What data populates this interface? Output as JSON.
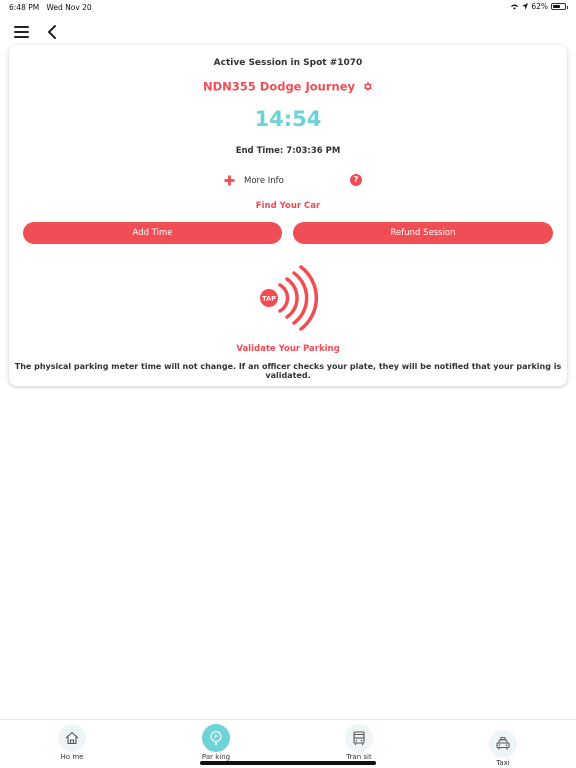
{
  "status_bar": {
    "time": "6:48 PM",
    "date": "Wed Nov 20",
    "battery": "62%",
    "battery_level": 0.62
  },
  "nav": {
    "menu_icon": "hamburger-menu-icon",
    "back_icon": "chevron-left-icon"
  },
  "session": {
    "title": "Active Session in Spot  #1070",
    "vehicle": "NDN355 Dodge Journey",
    "timer": "14:54",
    "end_time_label": "End Time: ",
    "end_time_value": "7:03:36 PM",
    "more_info": "More Info",
    "help_symbol": "?",
    "find_car": "Find Your Car",
    "add_time": "Add Time",
    "refund": "Refund Session",
    "tap_label": "TAP",
    "validate": "Validate Your Parking",
    "validate_note": "The physical parking meter time will not change. If an officer checks your plate, they will be notified that your parking is validated."
  },
  "tabs": [
    {
      "label": "Ho me",
      "icon": "home-icon",
      "active": false
    },
    {
      "label": "Par king",
      "icon": "parking-meter-icon",
      "active": true
    },
    {
      "label": "Tran sit",
      "icon": "bus-icon",
      "active": false
    },
    {
      "label": "Taxi",
      "icon": "taxi-icon",
      "active": false
    }
  ],
  "colors": {
    "accent": "#f04d55",
    "timer": "#6ed3d8",
    "active_tab": "#6ed3d8"
  }
}
